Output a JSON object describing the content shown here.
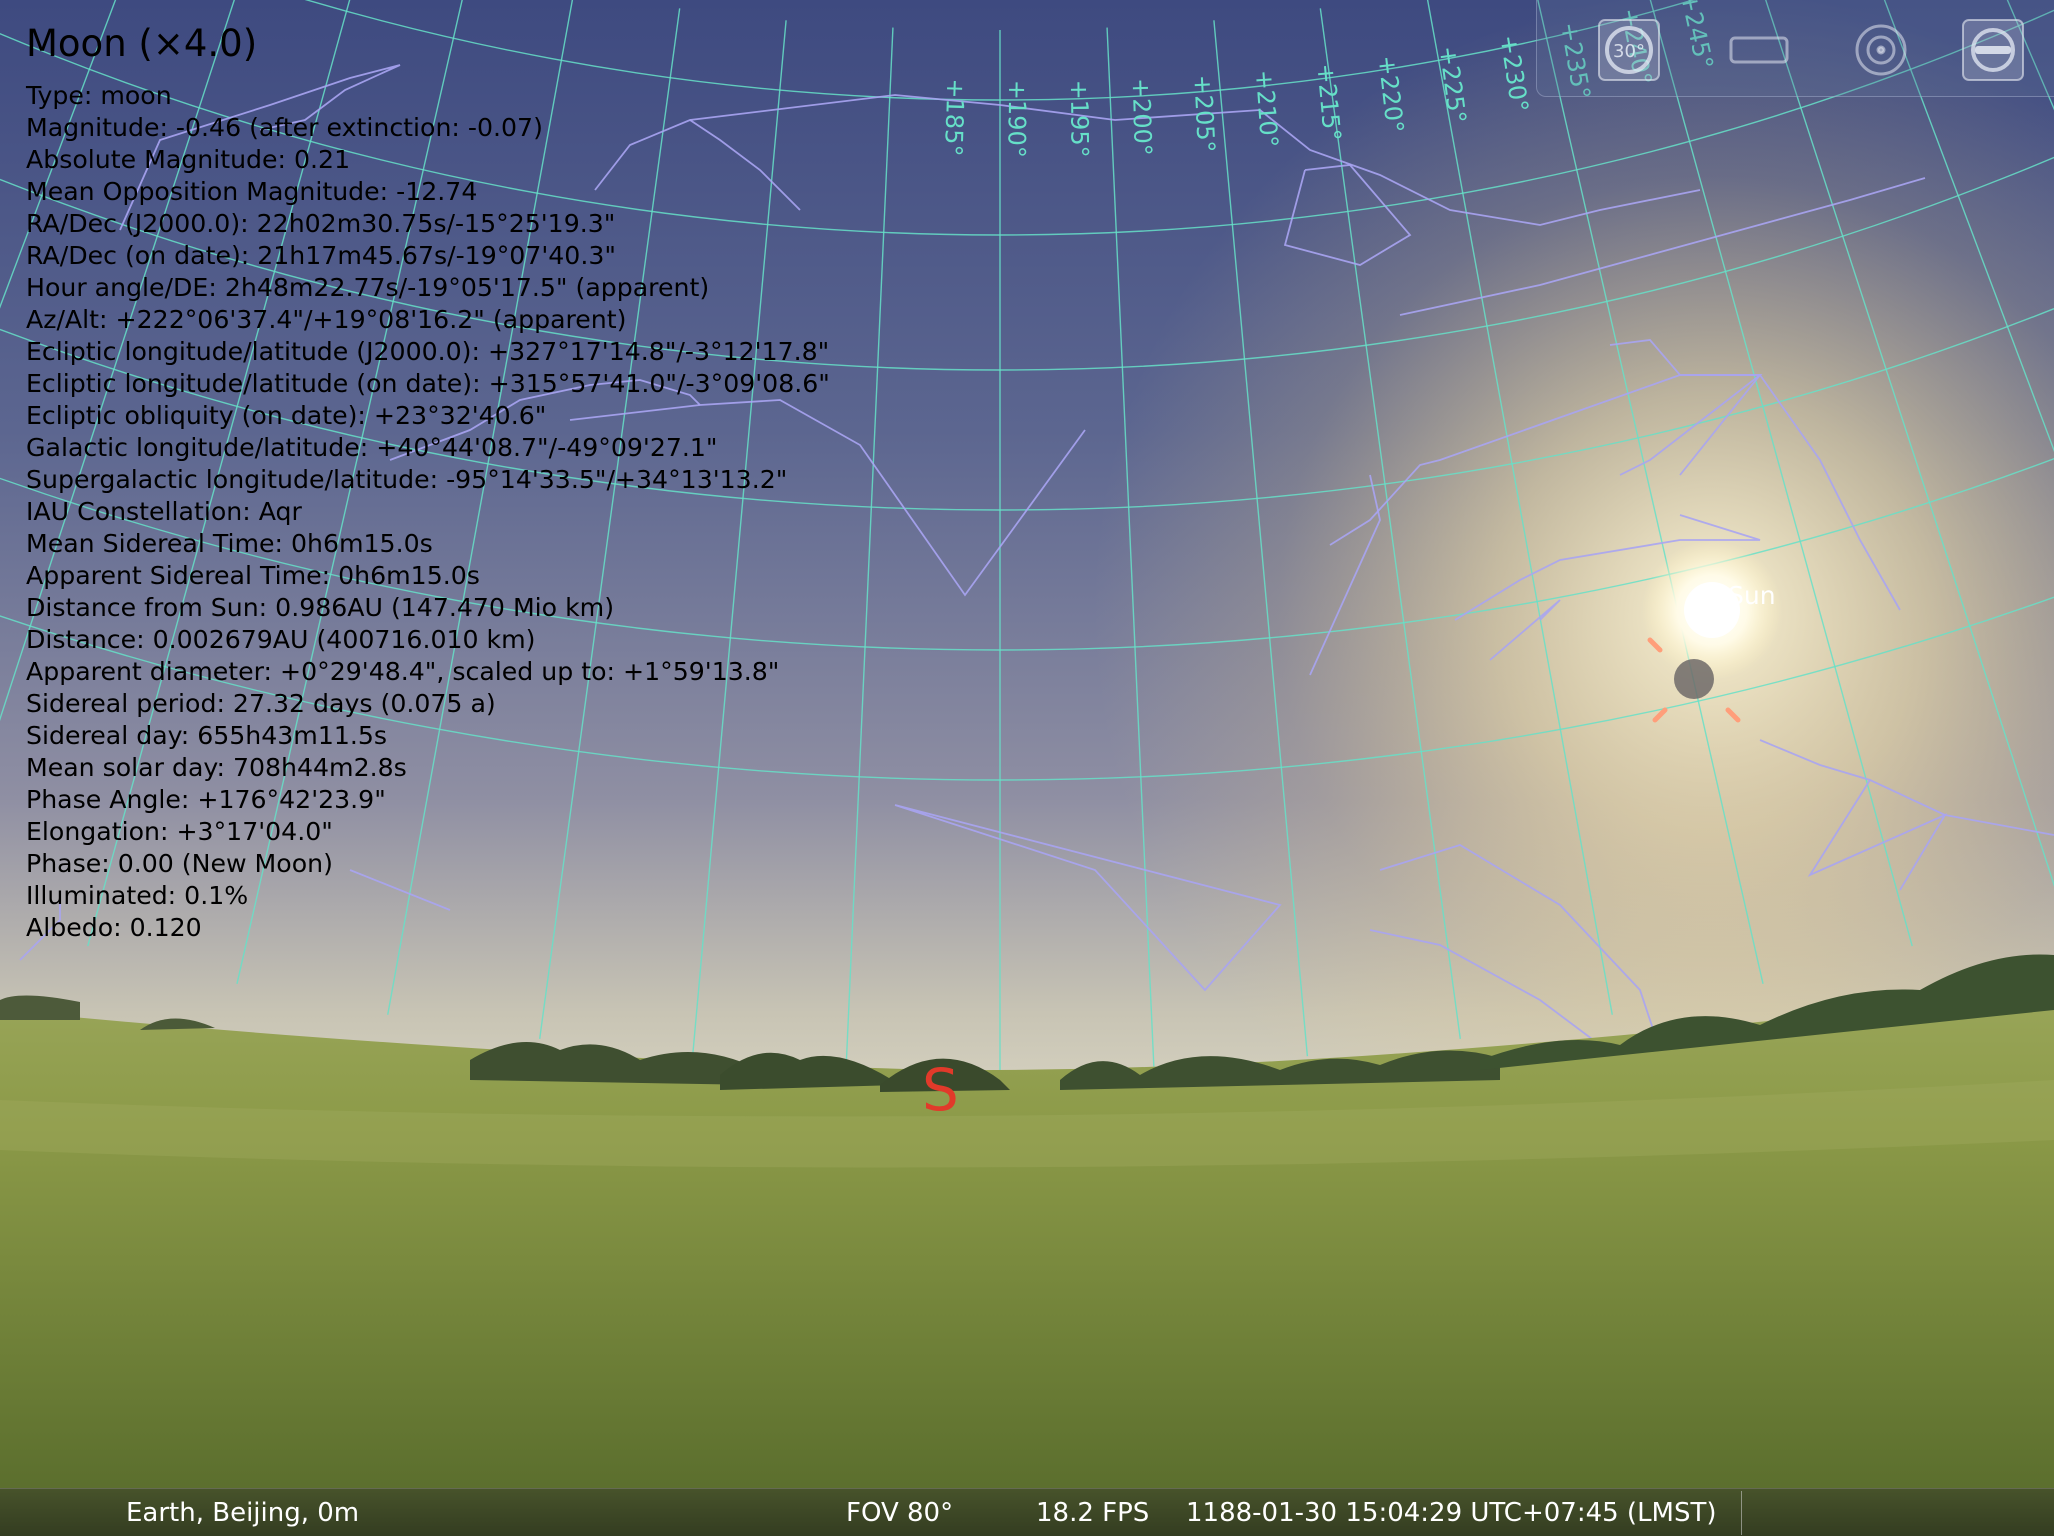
{
  "info": {
    "title": "Moon (×4.0)",
    "lines": [
      "Type: moon",
      "Magnitude: -0.46 (after extinction: -0.07)",
      "Absolute Magnitude: 0.21",
      "Mean Opposition Magnitude: -12.74",
      "RA/Dec (J2000.0): 22h02m30.75s/-15°25'19.3\"",
      "RA/Dec (on date): 21h17m45.67s/-19°07'40.3\"",
      "Hour angle/DE: 2h48m22.77s/-19°05'17.5\" (apparent)",
      "Az/Alt: +222°06'37.4\"/+19°08'16.2\" (apparent)",
      "Ecliptic longitude/latitude (J2000.0): +327°17'14.8\"/-3°12'17.8\"",
      "Ecliptic longitude/latitude (on date): +315°57'41.0\"/-3°09'08.6\"",
      "Ecliptic obliquity (on date): +23°32'40.6\"",
      "Galactic longitude/latitude: +40°44'08.7\"/-49°09'27.1\"",
      "Supergalactic longitude/latitude: -95°14'33.5\"/+34°13'13.2\"",
      "IAU Constellation: Aqr",
      "Mean Sidereal Time: 0h6m15.0s",
      "Apparent Sidereal Time: 0h6m15.0s",
      "Distance from Sun: 0.986AU (147.470 Mio km)",
      "Distance: 0.002679AU (400716.010 km)",
      "Apparent diameter: +0°29'48.4\", scaled up to: +1°59'13.8\"",
      "Sidereal period: 27.32 days (0.075 a)",
      "Sidereal day: 655h43m11.5s",
      "Mean solar day: 708h44m2.8s",
      "Phase Angle: +176°42'23.9\"",
      "Elongation: +3°17'04.0\"",
      "Phase: 0.00 (New Moon)",
      "Illuminated: 0.1%",
      "Albedo: 0.120"
    ]
  },
  "sky": {
    "sun_label": "Sun",
    "compass_south": "S",
    "azimuth_labels": [
      "+185°",
      "+190°",
      "+195°",
      "+200°",
      "+205°",
      "+210°",
      "+215°",
      "+220°",
      "+225°",
      "+230°",
      "+235°",
      "+240°",
      "+245°"
    ],
    "grid_color": "#66e0c8",
    "constellation_color": "#a9a4f2"
  },
  "toolbar": {
    "buttons": [
      {
        "name": "fov-30-button",
        "icon": "fov-30-icon",
        "label": "30°"
      },
      {
        "name": "screen-frame-button",
        "icon": "rectangle-frame-icon"
      },
      {
        "name": "target-button",
        "icon": "target-circle-icon"
      },
      {
        "name": "tools-button",
        "icon": "wrench-icon"
      }
    ]
  },
  "status": {
    "location": "Earth, Beijing, 0m",
    "fov": "FOV 80°",
    "fps": "18.2 FPS",
    "datetime": "1188-01-30 15:04:29 UTC+07:45 (LMST)"
  }
}
